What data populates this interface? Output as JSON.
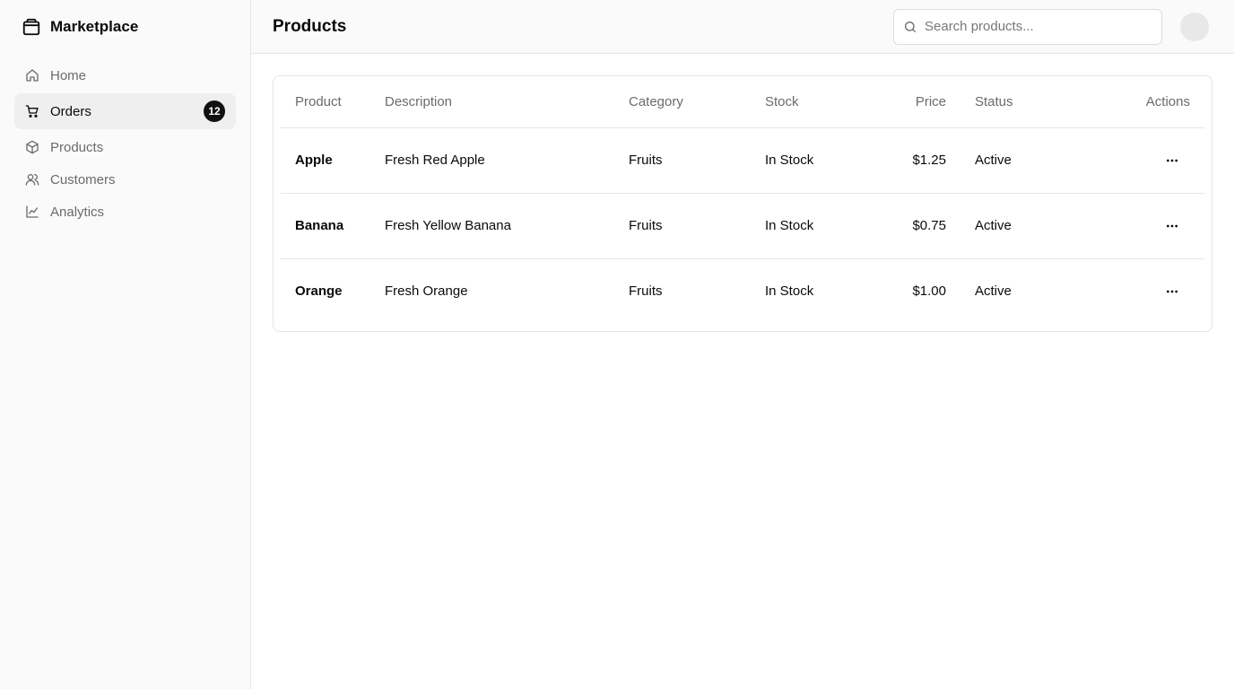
{
  "app": {
    "name": "Marketplace",
    "logo_icon": "package-icon"
  },
  "sidebar": {
    "items": [
      {
        "label": "Home",
        "icon": "home-icon",
        "active": false
      },
      {
        "label": "Orders",
        "icon": "cart-icon",
        "active": true,
        "badge": "12"
      },
      {
        "label": "Products",
        "icon": "box-icon",
        "active": false
      },
      {
        "label": "Customers",
        "icon": "users-icon",
        "active": false
      },
      {
        "label": "Analytics",
        "icon": "chart-line-icon",
        "active": false
      }
    ]
  },
  "header": {
    "title": "Products",
    "search_placeholder": "Search products...",
    "search_value": ""
  },
  "table": {
    "columns": {
      "product": "Product",
      "description": "Description",
      "category": "Category",
      "stock": "Stock",
      "price": "Price",
      "status": "Status",
      "actions": "Actions"
    },
    "rows": [
      {
        "product": "Apple",
        "description": "Fresh Red Apple",
        "category": "Fruits",
        "stock": "In Stock",
        "price": "$1.25",
        "status": "Active"
      },
      {
        "product": "Banana",
        "description": "Fresh Yellow Banana",
        "category": "Fruits",
        "stock": "In Stock",
        "price": "$0.75",
        "status": "Active"
      },
      {
        "product": "Orange",
        "description": "Fresh Orange",
        "category": "Fruits",
        "stock": "In Stock",
        "price": "$1.00",
        "status": "Active"
      }
    ]
  },
  "colors": {
    "sidebar_bg": "#fafafa",
    "active_bg": "#efefef",
    "badge_bg": "#111111",
    "border": "#e5e5e5",
    "muted_text": "#6b6b6b"
  }
}
